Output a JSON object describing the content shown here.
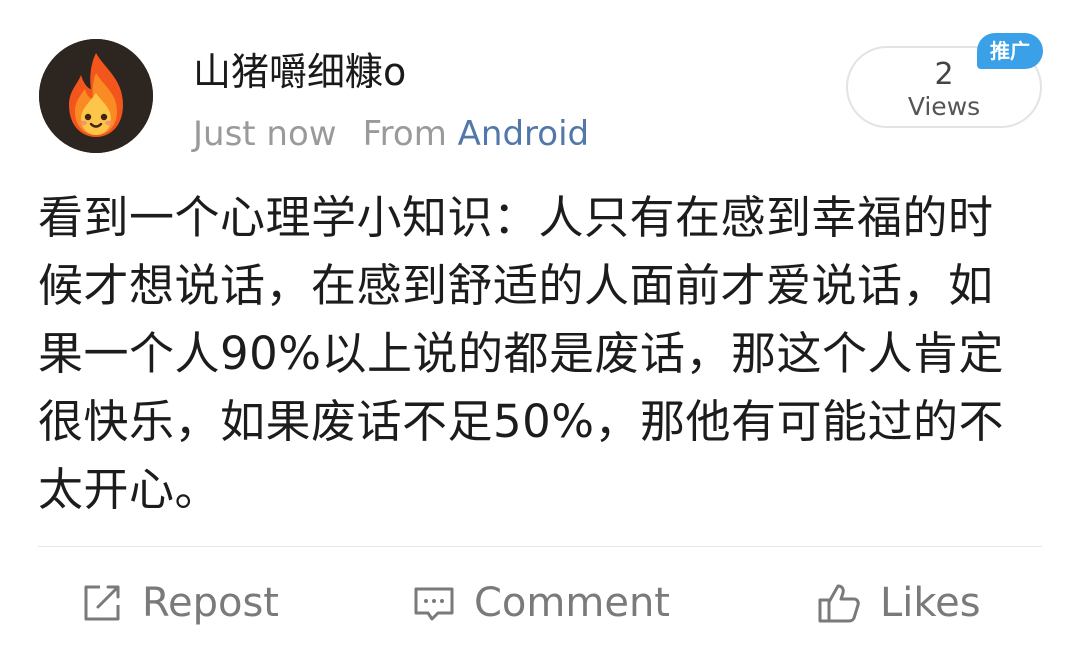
{
  "post": {
    "username": "山猪嚼细糠o",
    "time": "Just now",
    "source_prefix": "From",
    "source_app": "Android",
    "views_count": "2",
    "views_label": "Views",
    "promo_badge": "推广",
    "content": "看到一个心理学小知识：人只有在感到幸福的时候才想说话，在感到舒适的人面前才爱说话，如果一个人90%以上说的都是废话，那这个人肯定很快乐，如果废话不足50%，那他有可能过的不太开心。"
  },
  "actions": {
    "repost": "Repost",
    "comment": "Comment",
    "likes": "Likes"
  },
  "icons": {
    "avatar": "flame-character-avatar",
    "repost": "repost-icon",
    "comment": "comment-icon",
    "likes": "thumbs-up-icon"
  },
  "colors": {
    "source_app": "#5178a8",
    "promo_badge": "#3aa0e8",
    "meta_text": "#9a9a9a",
    "action_text": "#7a7a7a"
  }
}
